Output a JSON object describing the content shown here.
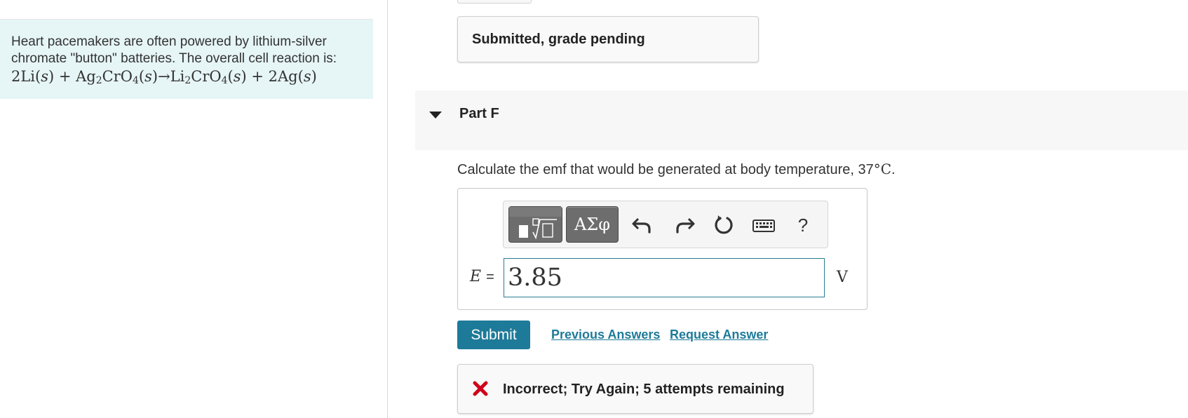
{
  "intro": {
    "text_line1": "Heart pacemakers are often powered by lithium-silver",
    "text_line2": "chromate \"button\" batteries. The overall cell reaction is:"
  },
  "submitted_status": "Submitted, grade pending",
  "part": {
    "title": "Part F",
    "question_text": "Calculate the emf that would be generated at body temperature, 37",
    "question_unit": "°C",
    "question_end": "."
  },
  "toolbar": {
    "templates_icon": "templates-icon",
    "symbols_label": "ΑΣφ",
    "help_label": "?"
  },
  "answer": {
    "variable": "E",
    "equals": "=",
    "value": "3.85",
    "unit": "V"
  },
  "actions": {
    "submit_label": "Submit",
    "previous_answers_label": "Previous Answers",
    "request_answer_label": "Request Answer"
  },
  "feedback": {
    "text": "Incorrect; Try Again; 5 attempts remaining",
    "status_color": "#d0021b"
  },
  "colors": {
    "accent": "#1e7a99",
    "intro_bg": "#e6f5f6",
    "input_border": "#2a7d8f"
  }
}
